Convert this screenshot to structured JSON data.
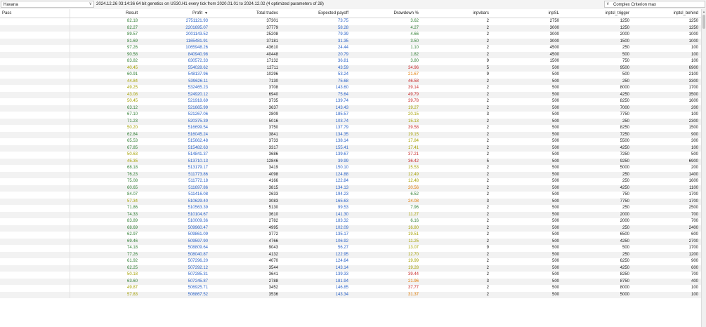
{
  "toolbar": {
    "symbol_select": "Havana",
    "info": "2024.12.26 03:14:36   64 bit genetics  on US30.H1 every tick  from 2020.01.01  to 2024.12.02  (4 optimized parameters of 28)",
    "criterion_select": "Complex Criterion max"
  },
  "columns": {
    "pass": "Pass",
    "result": "Result",
    "profit": "Profit",
    "trades": "Total trades",
    "payoff": "Expected payoff",
    "drawdown": "Drawdown %",
    "inpvbars": "inpvbars",
    "inpsl": "inpSL",
    "inptsl_trigger": "inptsl_trigger",
    "inptsl_behind": "inptsl_behind"
  },
  "colors": {
    "green": "#2e7d32",
    "olive": "#a4a000",
    "blue": "#2b63c8",
    "red": "#c62828",
    "orange": "#e07a00"
  },
  "rows": [
    [
      "82.18",
      "g",
      "2751121.93",
      "37301",
      "73.75",
      "3.62",
      "g",
      "2",
      "2750",
      "1250",
      "1250"
    ],
    [
      "82.27",
      "g",
      "2201695.07",
      "37779",
      "58.28",
      "4.27",
      "g",
      "2",
      "3000",
      "1250",
      "1250"
    ],
    [
      "89.57",
      "g",
      "2001143.52",
      "25208",
      "79.39",
      "4.66",
      "g",
      "2",
      "3000",
      "2000",
      "1000"
    ],
    [
      "81.69",
      "g",
      "1165481.91",
      "37181",
      "31.35",
      "3.50",
      "g",
      "2",
      "3000",
      "1500",
      "1000"
    ],
    [
      "97.26",
      "g",
      "1065948.26",
      "43610",
      "24.44",
      "1.10",
      "g",
      "2",
      "4500",
      "250",
      "100"
    ],
    [
      "90.58",
      "g",
      "840940.98",
      "40448",
      "20.79",
      "1.82",
      "g",
      "2",
      "4500",
      "500",
      "100"
    ],
    [
      "83.82",
      "g",
      "630572.33",
      "17132",
      "36.81",
      "3.80",
      "g",
      "9",
      "1500",
      "750",
      "100"
    ],
    [
      "40.45",
      "y",
      "554028.62",
      "12711",
      "43.59",
      "34.96",
      "r",
      "5",
      "500",
      "9500",
      "6900"
    ],
    [
      "60.91",
      "g",
      "548137.96",
      "10296",
      "53.24",
      "21.67",
      "o",
      "9",
      "500",
      "500",
      "2100"
    ],
    [
      "44.84",
      "y",
      "539626.11",
      "7130",
      "75.68",
      "46.58",
      "r",
      "2",
      "500",
      "250",
      "3300"
    ],
    [
      "49.25",
      "y",
      "532465.23",
      "3708",
      "143.60",
      "39.14",
      "r",
      "2",
      "500",
      "8000",
      "1700"
    ],
    [
      "43.08",
      "y",
      "524920.12",
      "6940",
      "75.64",
      "49.79",
      "r",
      "2",
      "500",
      "4250",
      "3500"
    ],
    [
      "50.45",
      "y",
      "521918.69",
      "3735",
      "139.74",
      "39.78",
      "r",
      "2",
      "500",
      "8250",
      "1600"
    ],
    [
      "63.12",
      "g",
      "521665.99",
      "3637",
      "143.43",
      "19.27",
      "y",
      "2",
      "500",
      "7000",
      "200"
    ],
    [
      "67.10",
      "g",
      "521267.06",
      "2809",
      "185.57",
      "20.15",
      "y",
      "3",
      "500",
      "7750",
      "100"
    ],
    [
      "71.23",
      "g",
      "520375.39",
      "5016",
      "103.74",
      "15.13",
      "y",
      "2",
      "500",
      "250",
      "2300"
    ],
    [
      "50.20",
      "y",
      "516699.54",
      "3750",
      "137.79",
      "39.58",
      "r",
      "2",
      "500",
      "8250",
      "1500"
    ],
    [
      "62.84",
      "g",
      "516045.24",
      "3841",
      "134.35",
      "19.15",
      "y",
      "2",
      "500",
      "7250",
      "900"
    ],
    [
      "65.53",
      "g",
      "515662.48",
      "3733",
      "138.14",
      "17.84",
      "y",
      "2",
      "500",
      "5500",
      "300"
    ],
    [
      "67.85",
      "g",
      "515482.63",
      "3317",
      "155.41",
      "17.41",
      "y",
      "2",
      "500",
      "4250",
      "100"
    ],
    [
      "50.63",
      "y",
      "514841.37",
      "3686",
      "139.67",
      "37.21",
      "r",
      "2",
      "500",
      "7250",
      "500"
    ],
    [
      "45.35",
      "y",
      "513710.13",
      "12846",
      "39.99",
      "36.42",
      "r",
      "5",
      "500",
      "9250",
      "6900"
    ],
    [
      "68.18",
      "g",
      "513179.17",
      "3419",
      "150.10",
      "15.53",
      "y",
      "2",
      "500",
      "5000",
      "200"
    ],
    [
      "76.23",
      "g",
      "511773.86",
      "4098",
      "124.88",
      "12.49",
      "y",
      "2",
      "500",
      "250",
      "1400"
    ],
    [
      "75.08",
      "g",
      "511772.18",
      "4166",
      "122.84",
      "12.48",
      "y",
      "2",
      "500",
      "250",
      "1600"
    ],
    [
      "60.65",
      "g",
      "511697.86",
      "3815",
      "134.13",
      "20.56",
      "o",
      "2",
      "500",
      "4250",
      "1100"
    ],
    [
      "84.07",
      "g",
      "511416.08",
      "2633",
      "194.23",
      "6.52",
      "g",
      "2",
      "500",
      "750",
      "1700"
    ],
    [
      "57.34",
      "y",
      "510629.40",
      "3083",
      "165.63",
      "24.08",
      "o",
      "3",
      "500",
      "7750",
      "1700"
    ],
    [
      "71.86",
      "g",
      "510563.39",
      "5130",
      "99.53",
      "7.96",
      "g",
      "2",
      "500",
      "250",
      "2500"
    ],
    [
      "74.33",
      "g",
      "510104.67",
      "3610",
      "141.30",
      "11.27",
      "y",
      "2",
      "500",
      "2000",
      "700"
    ],
    [
      "83.89",
      "g",
      "510009.36",
      "2782",
      "183.32",
      "6.16",
      "g",
      "2",
      "500",
      "2000",
      "700"
    ],
    [
      "68.69",
      "g",
      "509960.47",
      "4995",
      "102.09",
      "16.80",
      "y",
      "2",
      "500",
      "250",
      "2400"
    ],
    [
      "62.97",
      "g",
      "509861.09",
      "3772",
      "135.17",
      "19.51",
      "y",
      "2",
      "500",
      "6500",
      "600"
    ],
    [
      "69.46",
      "g",
      "509597.90",
      "4766",
      "106.92",
      "11.25",
      "y",
      "2",
      "500",
      "4250",
      "2700"
    ],
    [
      "74.18",
      "g",
      "508809.64",
      "9043",
      "56.27",
      "13.07",
      "y",
      "9",
      "500",
      "500",
      "1700"
    ],
    [
      "77.26",
      "g",
      "508040.87",
      "4132",
      "122.95",
      "12.70",
      "y",
      "2",
      "500",
      "250",
      "1200"
    ],
    [
      "61.92",
      "g",
      "507296.20",
      "4070",
      "124.64",
      "19.99",
      "y",
      "2",
      "500",
      "6250",
      "900"
    ],
    [
      "62.25",
      "g",
      "507292.12",
      "3544",
      "143.14",
      "19.28",
      "y",
      "2",
      "500",
      "4250",
      "600"
    ],
    [
      "50.18",
      "y",
      "507285.31",
      "3641",
      "139.33",
      "39.44",
      "r",
      "2",
      "500",
      "8250",
      "700"
    ],
    [
      "63.60",
      "g",
      "507245.87",
      "2788",
      "181.94",
      "21.96",
      "o",
      "3",
      "500",
      "8750",
      "400"
    ],
    [
      "49.87",
      "y",
      "506925.71",
      "3452",
      "146.85",
      "37.77",
      "r",
      "2",
      "500",
      "8000",
      "100"
    ],
    [
      "57.83",
      "y",
      "506867.52",
      "3536",
      "143.34",
      "31.37",
      "o",
      "2",
      "500",
      "5000",
      "100"
    ]
  ]
}
